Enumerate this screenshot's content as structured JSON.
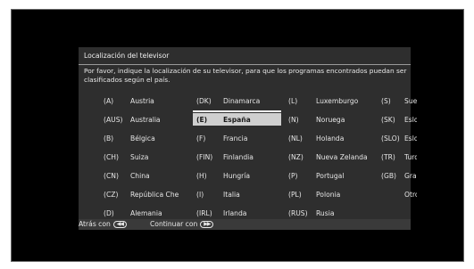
{
  "dialog": {
    "title": "Localización del televisor",
    "description": "Por favor, indique la localización de su televisor, para que los programas encontrados puedan ser clasificados según el país."
  },
  "countries": [
    {
      "code": "(A)",
      "name": "Austria"
    },
    {
      "code": "(AUS)",
      "name": "Australia"
    },
    {
      "code": "(B)",
      "name": "Bélgica"
    },
    {
      "code": "(CH)",
      "name": "Suiza"
    },
    {
      "code": "(CN)",
      "name": "China"
    },
    {
      "code": "(CZ)",
      "name": "República Che"
    },
    {
      "code": "(D)",
      "name": "Alemania"
    },
    {
      "code": "(DK)",
      "name": "Dinamarca"
    },
    {
      "code": "(E)",
      "name": "España"
    },
    {
      "code": "(F)",
      "name": "Francia"
    },
    {
      "code": "(FIN)",
      "name": "Finlandia"
    },
    {
      "code": "(H)",
      "name": "Hungría"
    },
    {
      "code": "(I)",
      "name": "Italia"
    },
    {
      "code": "(IRL)",
      "name": "Irlanda"
    },
    {
      "code": "(L)",
      "name": "Luxemburgo"
    },
    {
      "code": "(N)",
      "name": "Noruega"
    },
    {
      "code": "(NL)",
      "name": "Holanda"
    },
    {
      "code": "(NZ)",
      "name": "Nueva Zelanda"
    },
    {
      "code": "(P)",
      "name": "Portugal"
    },
    {
      "code": "(PL)",
      "name": "Polonia"
    },
    {
      "code": "(RUS)",
      "name": "Rusia"
    },
    {
      "code": "(S)",
      "name": "Suecia"
    },
    {
      "code": "(SK)",
      "name": "Eslovac"
    },
    {
      "code": "(SLO)",
      "name": "Esloven"
    },
    {
      "code": "(TR)",
      "name": "Turquía"
    },
    {
      "code": "(GB)",
      "name": "Gran Br"
    },
    {
      "code": "",
      "name": "Otros p"
    }
  ],
  "selected_country": "España",
  "footer": {
    "back_label": "Atrás con",
    "back_icon": "rewind-button-icon",
    "continue_label": "Continuar con",
    "continue_icon": "fast-forward-button-icon"
  },
  "colors": {
    "dialog_bg": "#2e2e2e",
    "selected_bg": "#cfcfcf",
    "screen_bg": "#000000"
  }
}
